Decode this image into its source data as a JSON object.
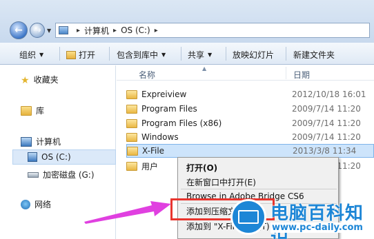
{
  "address": {
    "path": [
      "计算机",
      "OS (C:)"
    ]
  },
  "toolbar": {
    "organize": "组织",
    "open": "打开",
    "include_in_library": "包含到库中",
    "share": "共享",
    "slideshow": "放映幻灯片",
    "new_folder": "新建文件夹"
  },
  "nav": {
    "favorites": "收藏夹",
    "libraries": "库",
    "computer": "计算机",
    "os_c": "OS (C:)",
    "encrypted_g": "加密磁盘 (G:)",
    "network": "网络"
  },
  "columns": {
    "name": "名称",
    "date": "日期"
  },
  "files": [
    {
      "name": "Expreiview",
      "date": "2012/10/18 16:01"
    },
    {
      "name": "Program Files",
      "date": "2009/7/14 11:20"
    },
    {
      "name": "Program Files (x86)",
      "date": "2009/7/14 11:20"
    },
    {
      "name": "Windows",
      "date": "2009/7/14 11:20"
    },
    {
      "name": "X-File",
      "date": "2013/3/8 11:34"
    },
    {
      "name": "用户",
      "date": "2009/7/14 11:20"
    }
  ],
  "context_menu": {
    "open": "打开(O)",
    "open_new_window": "在新窗口中打开(E)",
    "browse_bridge": "Browse in Adobe Bridge CS6",
    "add_to_archive": "添加到压缩文件(A)...",
    "add_to_x": "添加到 \"X-File.rar\"(T)"
  },
  "watermark": {
    "title": "电脑百科知识",
    "url": "www.pc-daily.com"
  },
  "colors": {
    "highlight_box": "#e8352e",
    "arrow": "#e040e0",
    "watermark_blue": "#1d86d6"
  },
  "icons": {
    "back": "back-arrow-icon",
    "forward": "forward-arrow-icon",
    "computer": "computer-icon",
    "folder": "folder-icon",
    "star": "star-icon",
    "drive": "drive-icon",
    "network": "network-icon"
  }
}
